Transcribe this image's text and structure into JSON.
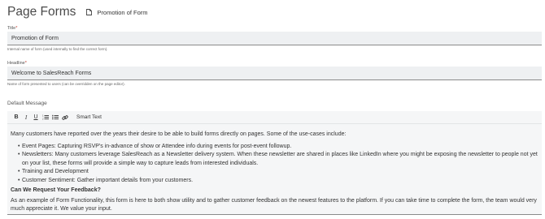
{
  "header": {
    "title": "Page Forms",
    "breadcrumb_icon": "document-icon",
    "breadcrumb_label": "Promotion of Form"
  },
  "form": {
    "title_label": "Title",
    "title_value": "Promotion of Form",
    "title_hint": "Internal name of form (used internally to find the correct form).",
    "headline_label": "Headline",
    "headline_value": "Welcome to SalesReach Forms",
    "headline_hint": "Name of form presented to users (can be overridden on the page editor).",
    "required_marker": "*"
  },
  "default_message": {
    "label": "Default Message",
    "toolbar": {
      "bold": "B",
      "italic": "I",
      "underline": "U",
      "ordered_list_icon": "ordered-list-icon",
      "bullet_list_icon": "bullet-list-icon",
      "link_icon": "link-icon",
      "smart_text": "Smart Text"
    },
    "intro": "Many customers have reported over the years their desire to be able to build forms directly on pages. Some of the use-cases include:",
    "bullets": [
      "Event Pages: Capturing RSVP's in-advance of show or Attendee info during events for post-event followup.",
      "Newsletters: Many customers leverage SalesReach as a Newsletter delivery system. When these newsletter are shared in places like LinkedIn where you might be exposing the newsletter to people not yet on your list, these forms will provide a simple way to capture leads from interested individuals.",
      "Training and Development",
      "Customer Sentiment: Gather important details from your customers."
    ],
    "subheading": "Can We Request Your Feedback?",
    "closing": "As an example of Form Functionality, this form is here to both show utility and to gather customer feedback on the newest features to the platform. If you can take time to complete the form, the team would very much appreciate it. We value your input."
  }
}
